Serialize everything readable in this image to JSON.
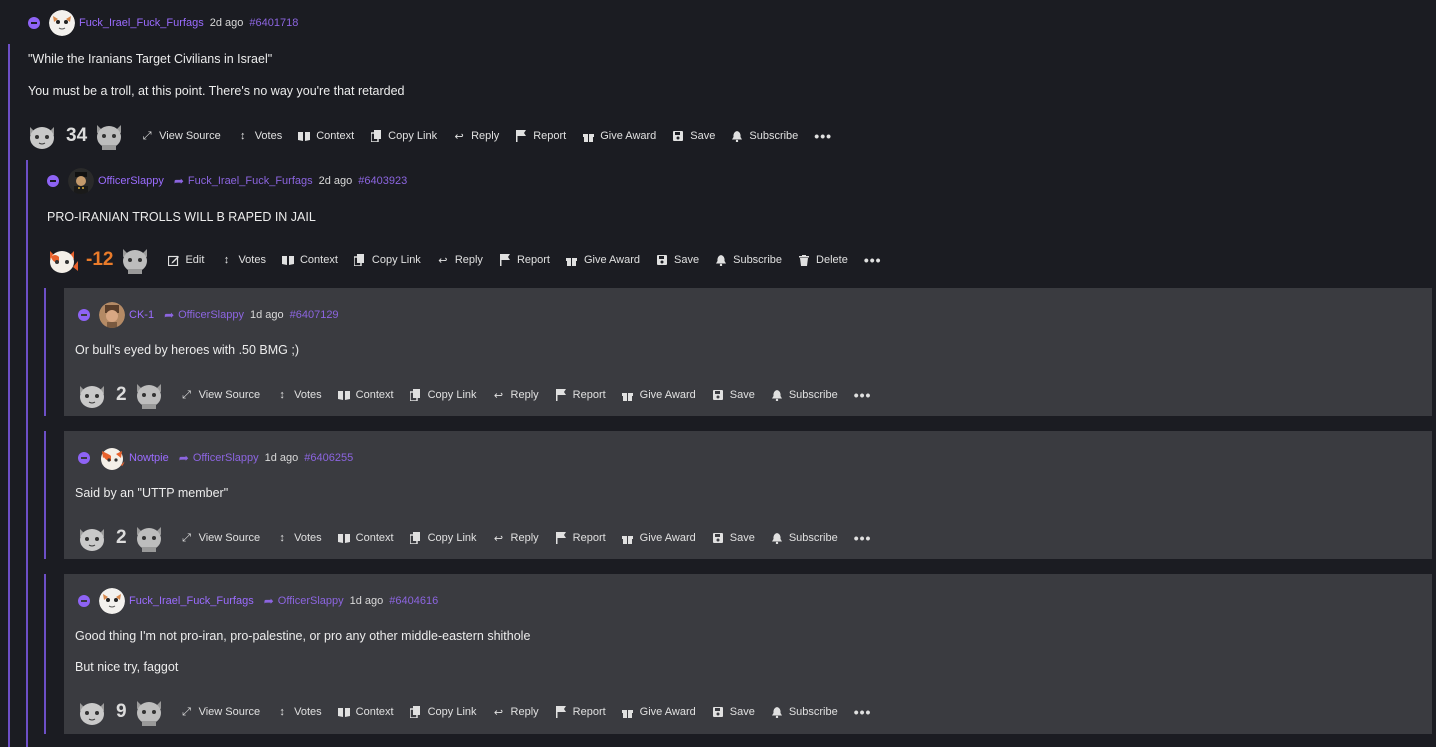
{
  "comments": [
    {
      "username": "Fuck_Irael_Fuck_Furfags",
      "time": "2d ago",
      "id": "#6401718",
      "paragraphs": [
        "\"While the Iranians Target Civilians in Israel\"",
        "You must be a troll, at this point. There's no way you're that retarded"
      ],
      "score": "34",
      "actions": [
        "View Source",
        "Votes",
        "Context",
        "Copy Link",
        "Reply",
        "Report",
        "Give Award",
        "Save",
        "Subscribe"
      ]
    },
    {
      "username": "OfficerSlappy",
      "reply_to": "Fuck_Irael_Fuck_Furfags",
      "time": "2d ago",
      "id": "#6403923",
      "paragraphs": [
        "PRO-IRANIAN TROLLS WILL B RAPED IN JAIL"
      ],
      "score": "-12",
      "actions": [
        "Edit",
        "Votes",
        "Context",
        "Copy Link",
        "Reply",
        "Report",
        "Give Award",
        "Save",
        "Subscribe",
        "Delete"
      ]
    },
    {
      "username": "CK-1",
      "reply_to": "OfficerSlappy",
      "time": "1d ago",
      "id": "#6407129",
      "paragraphs": [
        "Or bull's eyed by heroes with .50 BMG ;)"
      ],
      "score": "2",
      "actions": [
        "View Source",
        "Votes",
        "Context",
        "Copy Link",
        "Reply",
        "Report",
        "Give Award",
        "Save",
        "Subscribe"
      ]
    },
    {
      "username": "Nowtpie",
      "reply_to": "OfficerSlappy",
      "time": "1d ago",
      "id": "#6406255",
      "paragraphs": [
        "Said by an \"UTTP member\""
      ],
      "score": "2",
      "actions": [
        "View Source",
        "Votes",
        "Context",
        "Copy Link",
        "Reply",
        "Report",
        "Give Award",
        "Save",
        "Subscribe"
      ]
    },
    {
      "username": "Fuck_Irael_Fuck_Furfags",
      "reply_to": "OfficerSlappy",
      "time": "1d ago",
      "id": "#6404616",
      "paragraphs": [
        "Good thing I'm not pro-iran, pro-palestine, or pro any other middle-eastern shithole",
        "But nice try, faggot"
      ],
      "score": "9",
      "actions": [
        "View Source",
        "Votes",
        "Context",
        "Copy Link",
        "Reply",
        "Report",
        "Give Award",
        "Save",
        "Subscribe"
      ]
    }
  ],
  "icons": {
    "collapse": "collapse-icon",
    "upvote": "cat-upvote-icon",
    "downvote": "cat-downvote-icon",
    "View Source": "expand-icon",
    "Edit": "edit-icon",
    "Votes": "votes-arrows-icon",
    "Context": "book-icon",
    "Copy Link": "copy-icon",
    "Reply": "reply-arrow-icon",
    "Report": "flag-icon",
    "Give Award": "gift-icon",
    "Save": "floppy-icon",
    "Subscribe": "bell-icon",
    "Delete": "trash-icon",
    "more": "ellipsis-icon"
  },
  "colors": {
    "background": "#1b1c22",
    "card": "#3a3b40",
    "username": "#9b6cff",
    "thread_line": "#6d4fc7",
    "negative_score": "#ea7b2a"
  }
}
